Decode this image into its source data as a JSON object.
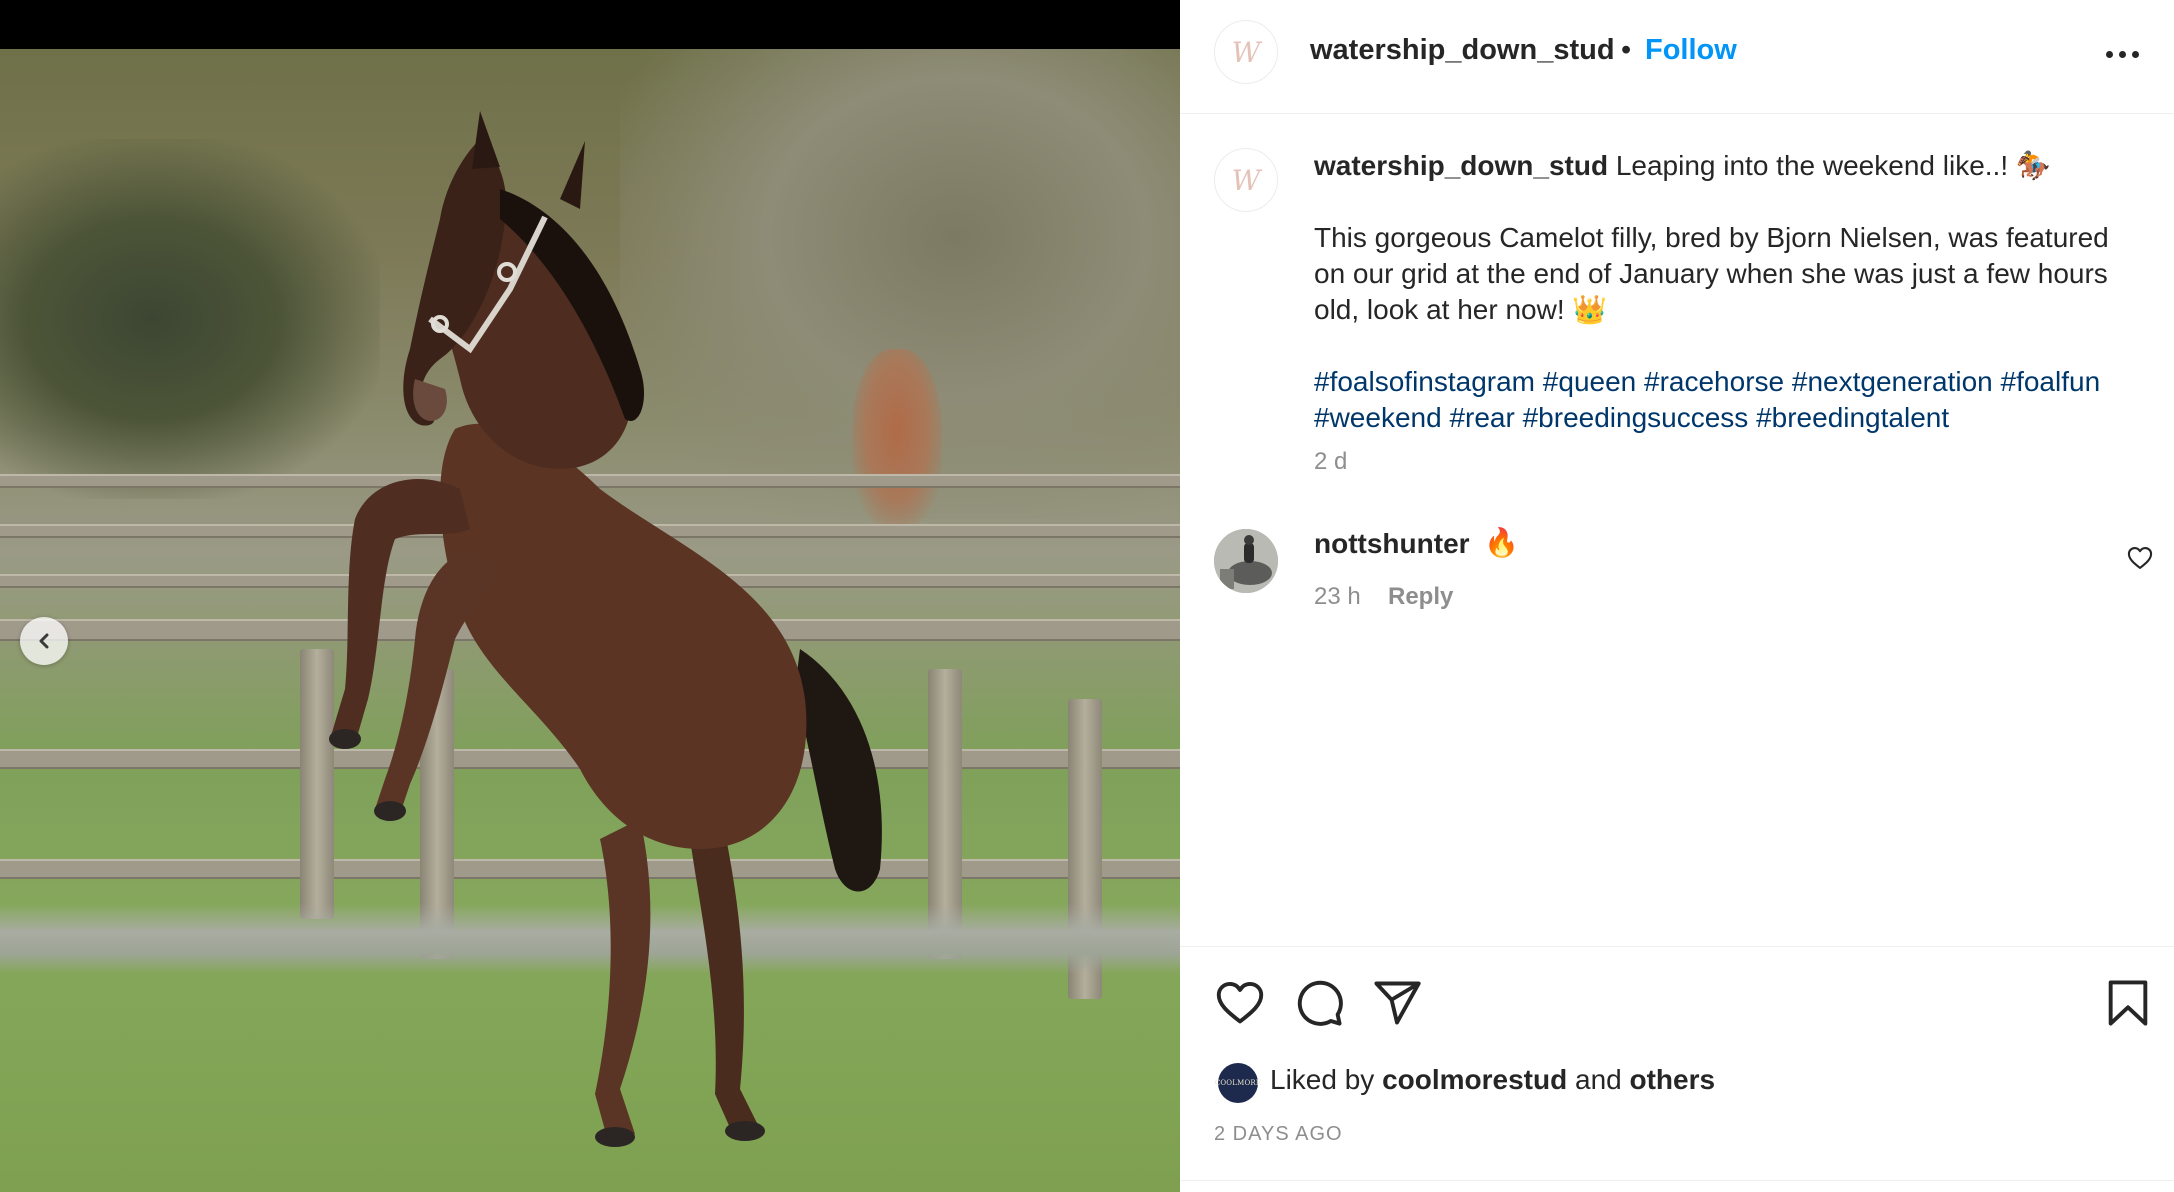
{
  "post": {
    "image_alt": "Foal rearing in a paddock"
  },
  "header": {
    "avatar_glyph": "W",
    "username": "watership_down_stud",
    "separator": "•",
    "follow_label": "Follow",
    "more_icon": "more-horizontal-icon"
  },
  "caption": {
    "username": "watership_down_stud",
    "first_line": "Leaping into the weekend like..! 🏇",
    "body": "This gorgeous Camelot filly, bred by Bjorn Nielsen, was featured on our grid at the end of January when she was just a few hours old, look at her now! 👑",
    "hashtags": [
      "#foalsofinstagram",
      "#queen",
      "#racehorse",
      "#nextgeneration",
      "#foalfun",
      "#weekend",
      "#rear",
      "#breedingsuccess",
      "#breedingtalent"
    ],
    "time": "2 d"
  },
  "comments": [
    {
      "username": "nottshunter",
      "text": "🔥",
      "time": "23 h",
      "reply_label": "Reply"
    }
  ],
  "actions": {
    "like_icon": "heart-icon",
    "comment_icon": "comment-icon",
    "share_icon": "send-icon",
    "save_icon": "bookmark-icon"
  },
  "likes": {
    "avatar_text": "COOLMORE",
    "prefix": "Liked by",
    "user": "coolmorestud",
    "joiner": "and",
    "others": "others"
  },
  "date": "2 DAYS AGO",
  "colors": {
    "link_blue": "#0095f6",
    "hashtag": "#00376b",
    "muted": "#8e8e8e"
  }
}
